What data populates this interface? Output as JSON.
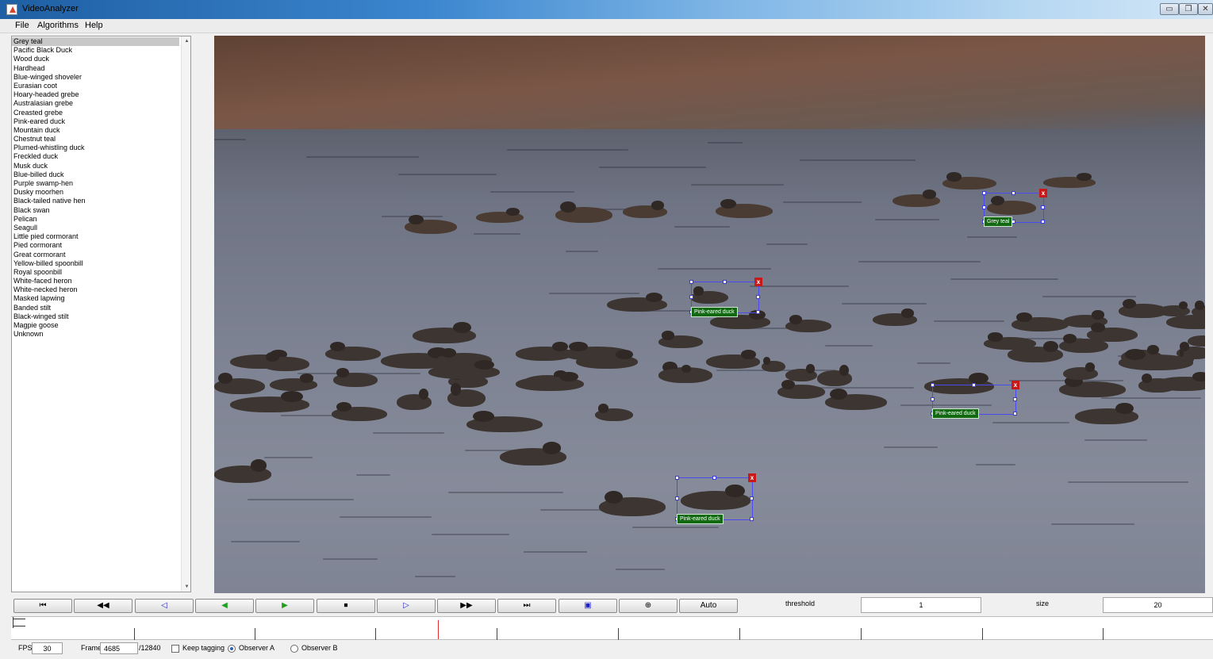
{
  "window": {
    "title": "VideoAnalyzer",
    "minimize_icon": "minimize-icon",
    "restore_icon": "restore-icon",
    "close_icon": "close-icon"
  },
  "menu": {
    "items": [
      "File",
      "Algorithms",
      "Help"
    ]
  },
  "species": {
    "selected": "Grey teal",
    "items": [
      "Grey teal",
      "Pacific Black Duck",
      "Wood duck",
      "Hardhead",
      "Blue-winged shoveler",
      "Eurasian coot",
      "Hoary-headed grebe",
      "Australasian grebe",
      "Creasted grebe",
      "Pink-eared duck",
      "Mountain duck",
      "Chestnut teal",
      "Plumed-whistling duck",
      "Freckled duck",
      "Musk duck",
      "Blue-billed duck",
      "Purple swamp-hen",
      "Dusky moorhen",
      "Black-tailed native hen",
      "Black swan",
      "Pelican",
      "Seagull",
      "Little pied cormorant",
      "Pied cormorant",
      "Great cormorant",
      "Yellow-billed spoonbill",
      "Royal spoonbill",
      "White-faced heron",
      "White-necked heron",
      "Masked lapwing",
      "Banded stilt",
      "Black-winged stilt",
      "Magpie goose",
      "Unknown"
    ]
  },
  "annotations": [
    {
      "label": "Grey teal",
      "close": "x"
    },
    {
      "label": "Pink-eared duck",
      "close": "x"
    },
    {
      "label": "Pink-eared duck",
      "close": "x"
    },
    {
      "label": "Pink-eared duck",
      "close": "x"
    }
  ],
  "controls": {
    "buttons": [
      {
        "name": "first-frame-button",
        "icon": "skip-to-start-icon",
        "glyph": "⏮"
      },
      {
        "name": "rewind-button",
        "icon": "rewind-icon",
        "glyph": "◀◀"
      },
      {
        "name": "step-back-button",
        "icon": "step-back-icon",
        "glyph": "◁"
      },
      {
        "name": "play-reverse-button",
        "icon": "play-reverse-icon",
        "glyph": "◀"
      },
      {
        "name": "play-button",
        "icon": "play-icon",
        "glyph": "▶"
      },
      {
        "name": "stop-button",
        "icon": "stop-icon",
        "glyph": "⏹"
      },
      {
        "name": "step-forward-button",
        "icon": "step-forward-icon",
        "glyph": "▷"
      },
      {
        "name": "fast-forward-button",
        "icon": "fast-forward-icon",
        "glyph": "▶▶"
      },
      {
        "name": "last-frame-button",
        "icon": "skip-to-end-icon",
        "glyph": "⏭"
      },
      {
        "name": "select-region-button",
        "icon": "select-box-icon",
        "glyph": "▣"
      },
      {
        "name": "zoom-button",
        "icon": "zoom-in-icon",
        "glyph": "⊕"
      }
    ],
    "auto_label": "Auto",
    "threshold_label": "threshold",
    "threshold_value": "1",
    "size_label": "size",
    "size_value": "20"
  },
  "timeline": {
    "current_frame": 4685,
    "total_frames": 12840
  },
  "status": {
    "fps_label": "FPS",
    "fps_value": "30",
    "frame_label": "Frame",
    "frame_value": "4685",
    "frame_total": "/12840",
    "keep_tagging_label": "Keep tagging",
    "keep_tagging_checked": false,
    "observer_a_label": "Observer A",
    "observer_b_label": "Observer B",
    "selected_observer": "Observer A"
  }
}
